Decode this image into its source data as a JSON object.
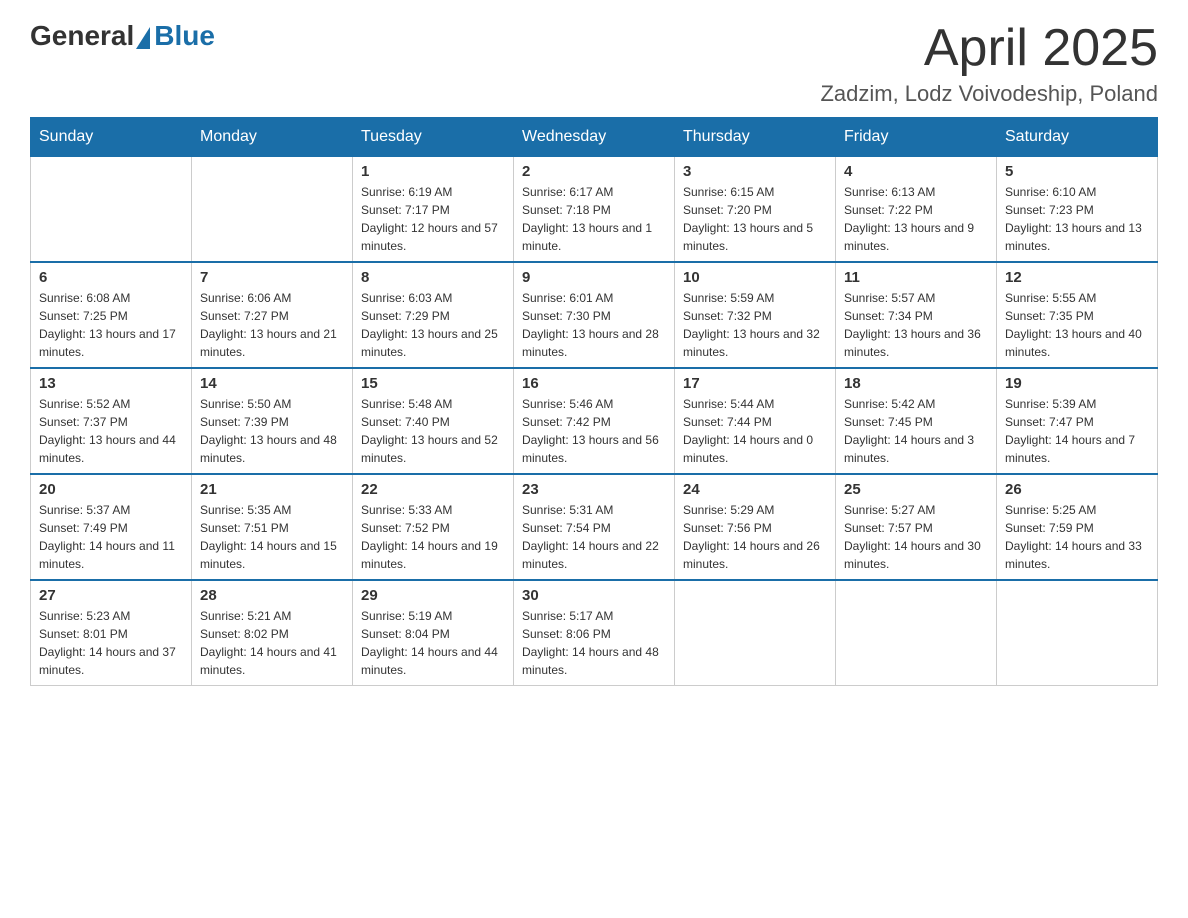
{
  "header": {
    "logo_general": "General",
    "logo_blue": "Blue",
    "month_title": "April 2025",
    "location": "Zadzim, Lodz Voivodeship, Poland"
  },
  "weekdays": [
    "Sunday",
    "Monday",
    "Tuesday",
    "Wednesday",
    "Thursday",
    "Friday",
    "Saturday"
  ],
  "weeks": [
    [
      {
        "day": "",
        "sunrise": "",
        "sunset": "",
        "daylight": ""
      },
      {
        "day": "",
        "sunrise": "",
        "sunset": "",
        "daylight": ""
      },
      {
        "day": "1",
        "sunrise": "Sunrise: 6:19 AM",
        "sunset": "Sunset: 7:17 PM",
        "daylight": "Daylight: 12 hours and 57 minutes."
      },
      {
        "day": "2",
        "sunrise": "Sunrise: 6:17 AM",
        "sunset": "Sunset: 7:18 PM",
        "daylight": "Daylight: 13 hours and 1 minute."
      },
      {
        "day": "3",
        "sunrise": "Sunrise: 6:15 AM",
        "sunset": "Sunset: 7:20 PM",
        "daylight": "Daylight: 13 hours and 5 minutes."
      },
      {
        "day": "4",
        "sunrise": "Sunrise: 6:13 AM",
        "sunset": "Sunset: 7:22 PM",
        "daylight": "Daylight: 13 hours and 9 minutes."
      },
      {
        "day": "5",
        "sunrise": "Sunrise: 6:10 AM",
        "sunset": "Sunset: 7:23 PM",
        "daylight": "Daylight: 13 hours and 13 minutes."
      }
    ],
    [
      {
        "day": "6",
        "sunrise": "Sunrise: 6:08 AM",
        "sunset": "Sunset: 7:25 PM",
        "daylight": "Daylight: 13 hours and 17 minutes."
      },
      {
        "day": "7",
        "sunrise": "Sunrise: 6:06 AM",
        "sunset": "Sunset: 7:27 PM",
        "daylight": "Daylight: 13 hours and 21 minutes."
      },
      {
        "day": "8",
        "sunrise": "Sunrise: 6:03 AM",
        "sunset": "Sunset: 7:29 PM",
        "daylight": "Daylight: 13 hours and 25 minutes."
      },
      {
        "day": "9",
        "sunrise": "Sunrise: 6:01 AM",
        "sunset": "Sunset: 7:30 PM",
        "daylight": "Daylight: 13 hours and 28 minutes."
      },
      {
        "day": "10",
        "sunrise": "Sunrise: 5:59 AM",
        "sunset": "Sunset: 7:32 PM",
        "daylight": "Daylight: 13 hours and 32 minutes."
      },
      {
        "day": "11",
        "sunrise": "Sunrise: 5:57 AM",
        "sunset": "Sunset: 7:34 PM",
        "daylight": "Daylight: 13 hours and 36 minutes."
      },
      {
        "day": "12",
        "sunrise": "Sunrise: 5:55 AM",
        "sunset": "Sunset: 7:35 PM",
        "daylight": "Daylight: 13 hours and 40 minutes."
      }
    ],
    [
      {
        "day": "13",
        "sunrise": "Sunrise: 5:52 AM",
        "sunset": "Sunset: 7:37 PM",
        "daylight": "Daylight: 13 hours and 44 minutes."
      },
      {
        "day": "14",
        "sunrise": "Sunrise: 5:50 AM",
        "sunset": "Sunset: 7:39 PM",
        "daylight": "Daylight: 13 hours and 48 minutes."
      },
      {
        "day": "15",
        "sunrise": "Sunrise: 5:48 AM",
        "sunset": "Sunset: 7:40 PM",
        "daylight": "Daylight: 13 hours and 52 minutes."
      },
      {
        "day": "16",
        "sunrise": "Sunrise: 5:46 AM",
        "sunset": "Sunset: 7:42 PM",
        "daylight": "Daylight: 13 hours and 56 minutes."
      },
      {
        "day": "17",
        "sunrise": "Sunrise: 5:44 AM",
        "sunset": "Sunset: 7:44 PM",
        "daylight": "Daylight: 14 hours and 0 minutes."
      },
      {
        "day": "18",
        "sunrise": "Sunrise: 5:42 AM",
        "sunset": "Sunset: 7:45 PM",
        "daylight": "Daylight: 14 hours and 3 minutes."
      },
      {
        "day": "19",
        "sunrise": "Sunrise: 5:39 AM",
        "sunset": "Sunset: 7:47 PM",
        "daylight": "Daylight: 14 hours and 7 minutes."
      }
    ],
    [
      {
        "day": "20",
        "sunrise": "Sunrise: 5:37 AM",
        "sunset": "Sunset: 7:49 PM",
        "daylight": "Daylight: 14 hours and 11 minutes."
      },
      {
        "day": "21",
        "sunrise": "Sunrise: 5:35 AM",
        "sunset": "Sunset: 7:51 PM",
        "daylight": "Daylight: 14 hours and 15 minutes."
      },
      {
        "day": "22",
        "sunrise": "Sunrise: 5:33 AM",
        "sunset": "Sunset: 7:52 PM",
        "daylight": "Daylight: 14 hours and 19 minutes."
      },
      {
        "day": "23",
        "sunrise": "Sunrise: 5:31 AM",
        "sunset": "Sunset: 7:54 PM",
        "daylight": "Daylight: 14 hours and 22 minutes."
      },
      {
        "day": "24",
        "sunrise": "Sunrise: 5:29 AM",
        "sunset": "Sunset: 7:56 PM",
        "daylight": "Daylight: 14 hours and 26 minutes."
      },
      {
        "day": "25",
        "sunrise": "Sunrise: 5:27 AM",
        "sunset": "Sunset: 7:57 PM",
        "daylight": "Daylight: 14 hours and 30 minutes."
      },
      {
        "day": "26",
        "sunrise": "Sunrise: 5:25 AM",
        "sunset": "Sunset: 7:59 PM",
        "daylight": "Daylight: 14 hours and 33 minutes."
      }
    ],
    [
      {
        "day": "27",
        "sunrise": "Sunrise: 5:23 AM",
        "sunset": "Sunset: 8:01 PM",
        "daylight": "Daylight: 14 hours and 37 minutes."
      },
      {
        "day": "28",
        "sunrise": "Sunrise: 5:21 AM",
        "sunset": "Sunset: 8:02 PM",
        "daylight": "Daylight: 14 hours and 41 minutes."
      },
      {
        "day": "29",
        "sunrise": "Sunrise: 5:19 AM",
        "sunset": "Sunset: 8:04 PM",
        "daylight": "Daylight: 14 hours and 44 minutes."
      },
      {
        "day": "30",
        "sunrise": "Sunrise: 5:17 AM",
        "sunset": "Sunset: 8:06 PM",
        "daylight": "Daylight: 14 hours and 48 minutes."
      },
      {
        "day": "",
        "sunrise": "",
        "sunset": "",
        "daylight": ""
      },
      {
        "day": "",
        "sunrise": "",
        "sunset": "",
        "daylight": ""
      },
      {
        "day": "",
        "sunrise": "",
        "sunset": "",
        "daylight": ""
      }
    ]
  ]
}
